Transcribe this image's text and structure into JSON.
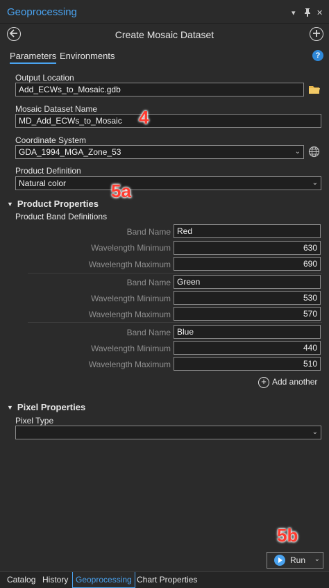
{
  "pane": {
    "title": "Geoprocessing",
    "menu_glyph": "▾",
    "pin_glyph": "📌",
    "close_glyph": "✕"
  },
  "header": {
    "tool_title": "Create Mosaic Dataset",
    "back_icon": "back-arrow-icon",
    "add_icon": "add-circle-icon"
  },
  "tabs": [
    {
      "label": "Parameters",
      "active": true
    },
    {
      "label": "Environments",
      "active": false
    }
  ],
  "help_glyph": "?",
  "params": {
    "output_location": {
      "label": "Output Location",
      "value": "Add_ECWs_to_Mosaic.gdb"
    },
    "mosaic_name": {
      "label": "Mosaic Dataset Name",
      "value": "MD_Add_ECWs_to_Mosaic"
    },
    "coordinate_system": {
      "label": "Coordinate System",
      "value": "GDA_1994_MGA_Zone_53"
    },
    "product_definition": {
      "label": "Product Definition",
      "value": "Natural color"
    }
  },
  "product_properties": {
    "section_title": "Product Properties",
    "subheading": "Product Band Definitions",
    "band_name_label": "Band Name",
    "wl_min_label": "Wavelength Minimum",
    "wl_max_label": "Wavelength Maximum",
    "bands": [
      {
        "name": "Red",
        "min": "630",
        "max": "690"
      },
      {
        "name": "Green",
        "min": "530",
        "max": "570"
      },
      {
        "name": "Blue",
        "min": "440",
        "max": "510"
      }
    ],
    "add_another": "Add another"
  },
  "pixel_properties": {
    "section_title": "Pixel Properties",
    "pixel_type_label": "Pixel Type",
    "pixel_type_value": ""
  },
  "annotations": {
    "a4": "4",
    "a5a": "5a",
    "a5b": "5b"
  },
  "run": {
    "label": "Run"
  },
  "bottom_tabs": [
    {
      "label": "Catalog",
      "active": false
    },
    {
      "label": "History",
      "active": false
    },
    {
      "label": "Geoprocessing",
      "active": true
    },
    {
      "label": "Chart Properties",
      "active": false
    }
  ],
  "colors": {
    "accent": "#4aa3f0",
    "annotation": "#ff3b30",
    "folder": "#e8b64c"
  }
}
